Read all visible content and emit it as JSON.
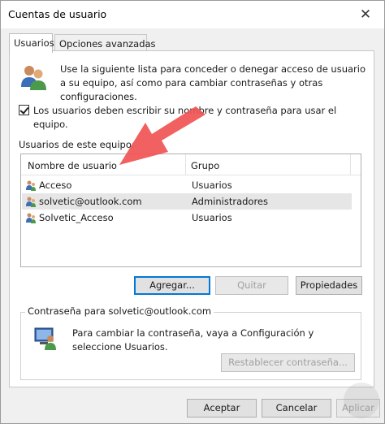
{
  "window": {
    "title": "Cuentas de usuario",
    "close_glyph": "✕"
  },
  "tabs": [
    {
      "label": "Usuarios",
      "active": true
    },
    {
      "label": "Opciones avanzadas",
      "active": false
    }
  ],
  "intro": {
    "text": "Use la siguiente lista para conceder o denegar acceso de usuario a su equipo, así como para cambiar contraseñas y otras configuraciones.",
    "icon": "users-icon"
  },
  "require_login": {
    "checked": true,
    "label": "Los usuarios deben escribir su nombre y contraseña para usar el equipo."
  },
  "user_list": {
    "label": "Usuarios de este equipo:",
    "columns": [
      "Nombre de usuario",
      "Grupo"
    ],
    "rows": [
      {
        "name": "Acceso",
        "group": "Usuarios",
        "selected": false
      },
      {
        "name": "solvetic@outlook.com",
        "group": "Administradores",
        "selected": true
      },
      {
        "name": "Solvetic_Acceso",
        "group": "Usuarios",
        "selected": false
      }
    ]
  },
  "list_buttons": {
    "add": "Agregar...",
    "remove": "Quitar",
    "properties": "Propiedades"
  },
  "password_section": {
    "legend": "Contraseña para solvetic@outlook.com",
    "text": "Para cambiar la contraseña, vaya a Configuración y seleccione Usuarios.",
    "reset": "Restablecer contraseña..."
  },
  "dialog_buttons": {
    "ok": "Aceptar",
    "cancel": "Cancelar",
    "apply": "Aplicar"
  },
  "colors": {
    "accent": "#0078d7",
    "annotation_arrow": "#f05454"
  }
}
